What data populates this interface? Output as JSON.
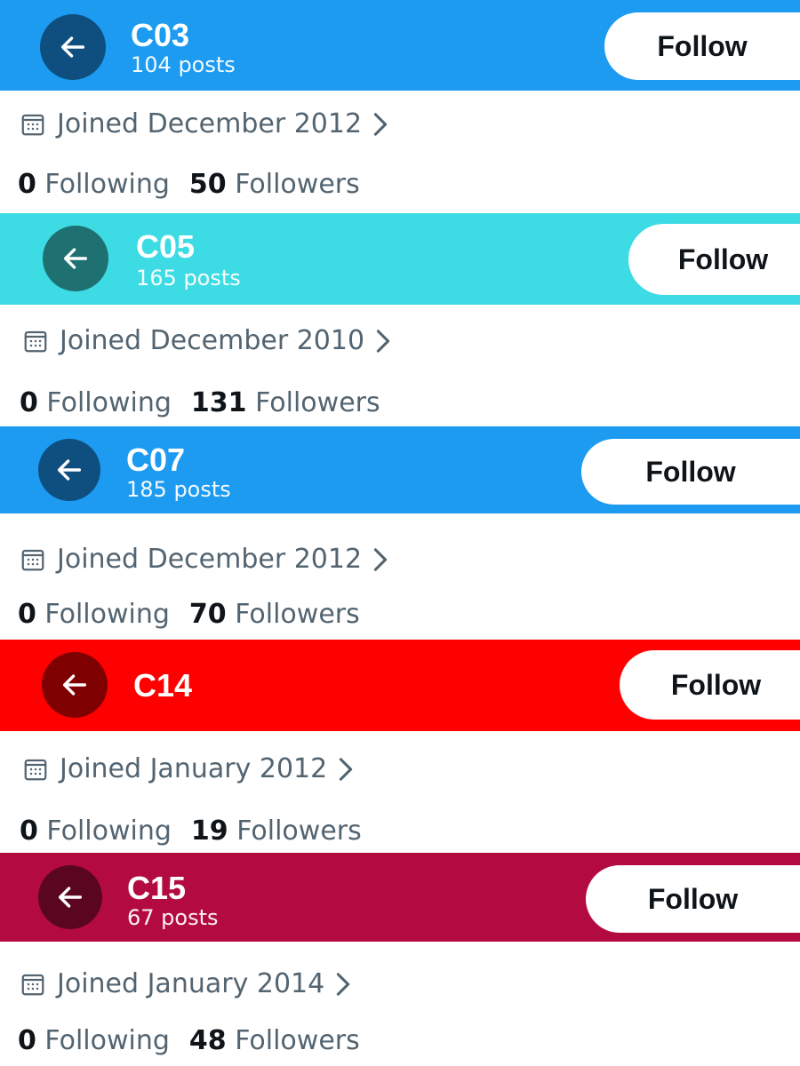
{
  "profiles": [
    {
      "name": "C03",
      "posts": "104 posts",
      "joined": "Joined December 2012",
      "following_count": "0",
      "following_label": "Following",
      "followers_count": "50",
      "followers_label": "Followers",
      "follow_label": "Follow",
      "header_color": "#1d9bf0",
      "back_color": "#0e4f7f"
    },
    {
      "name": "C05",
      "posts": "165 posts",
      "joined": "Joined December 2010",
      "following_count": "0",
      "following_label": "Following",
      "followers_count": "131",
      "followers_label": "Followers",
      "follow_label": "Follow",
      "header_color": "#3ddbe4",
      "back_color": "#1f7071"
    },
    {
      "name": "C07",
      "posts": "185 posts",
      "joined": "Joined December 2012",
      "following_count": "0",
      "following_label": "Following",
      "followers_count": "70",
      "followers_label": "Followers",
      "follow_label": "Follow",
      "header_color": "#1d9bf0",
      "back_color": "#0e4f7f"
    },
    {
      "name": "C14",
      "posts": "",
      "joined": "Joined January 2012",
      "following_count": "0",
      "following_label": "Following",
      "followers_count": "19",
      "followers_label": "Followers",
      "follow_label": "Follow",
      "header_color": "#fe0000",
      "back_color": "#7f0000"
    },
    {
      "name": "C15",
      "posts": "67 posts",
      "joined": "Joined January 2014",
      "following_count": "0",
      "following_label": "Following",
      "followers_count": "48",
      "followers_label": "Followers",
      "follow_label": "Follow",
      "header_color": "#b30b3f",
      "back_color": "#5a0620"
    }
  ],
  "icons": {
    "back": "arrow-left-icon",
    "calendar": "calendar-icon",
    "chevron": "chevron-right-icon"
  }
}
